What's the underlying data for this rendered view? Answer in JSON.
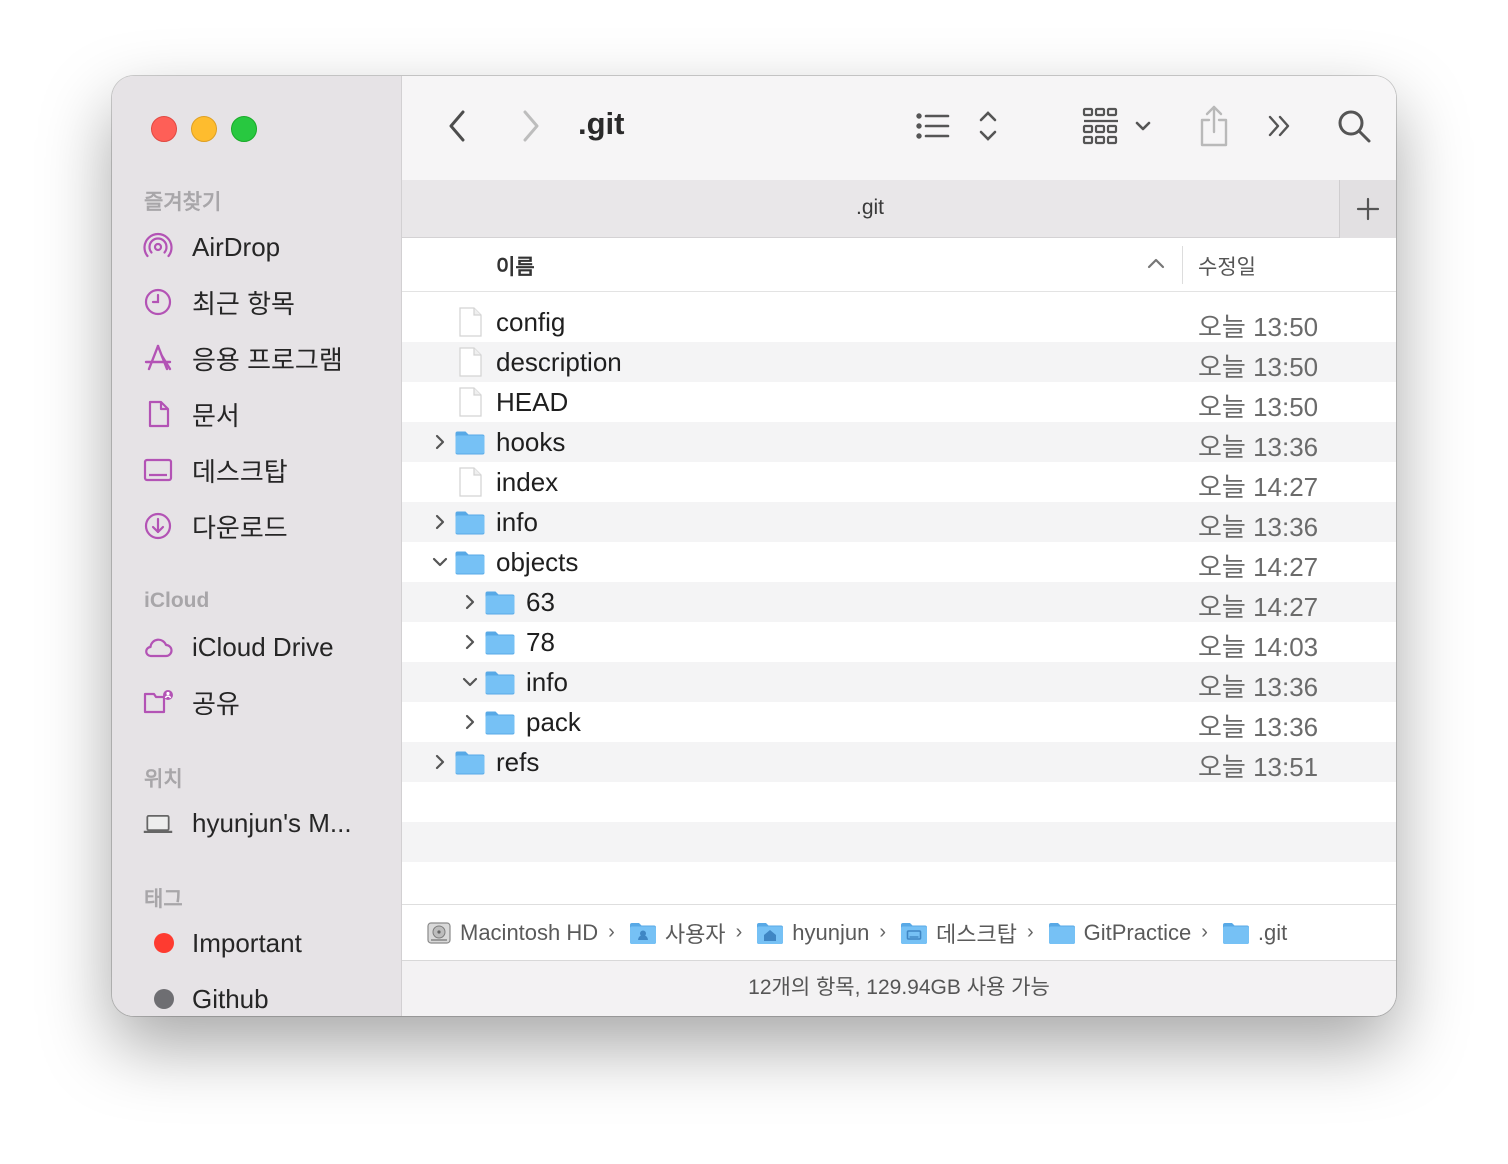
{
  "sidebar": {
    "sections": [
      {
        "title": "즐겨찾기",
        "items": [
          {
            "label": "AirDrop",
            "icon": "airdrop-icon"
          },
          {
            "label": "최근 항목",
            "icon": "clock-icon"
          },
          {
            "label": "응용 프로그램",
            "icon": "applications-icon"
          },
          {
            "label": "문서",
            "icon": "document-icon"
          },
          {
            "label": "데스크탑",
            "icon": "desktop-icon"
          },
          {
            "label": "다운로드",
            "icon": "download-icon"
          }
        ]
      },
      {
        "title": "iCloud",
        "items": [
          {
            "label": "iCloud Drive",
            "icon": "cloud-icon"
          },
          {
            "label": "공유",
            "icon": "shared-folder-icon"
          }
        ]
      },
      {
        "title": "위치",
        "items": [
          {
            "label": "hyunjun's M...",
            "icon": "laptop-icon"
          }
        ]
      },
      {
        "title": "태그",
        "items": [
          {
            "label": "Important",
            "color": "#fe3b30"
          },
          {
            "label": "Github",
            "color": "#6e6e72"
          }
        ]
      }
    ]
  },
  "toolbar": {
    "title": ".git"
  },
  "tab": {
    "label": ".git"
  },
  "columns": {
    "name": "이름",
    "modified": "수정일"
  },
  "rows": [
    {
      "name": "config",
      "date": "오늘 13:50",
      "kind": "file",
      "depth": 0,
      "expand": "none"
    },
    {
      "name": "description",
      "date": "오늘 13:50",
      "kind": "file",
      "depth": 0,
      "expand": "none"
    },
    {
      "name": "HEAD",
      "date": "오늘 13:50",
      "kind": "file",
      "depth": 0,
      "expand": "none"
    },
    {
      "name": "hooks",
      "date": "오늘 13:36",
      "kind": "folder",
      "depth": 0,
      "expand": "collapsed"
    },
    {
      "name": "index",
      "date": "오늘 14:27",
      "kind": "file",
      "depth": 0,
      "expand": "none"
    },
    {
      "name": "info",
      "date": "오늘 13:36",
      "kind": "folder",
      "depth": 0,
      "expand": "collapsed"
    },
    {
      "name": "objects",
      "date": "오늘 14:27",
      "kind": "folder",
      "depth": 0,
      "expand": "expanded"
    },
    {
      "name": "63",
      "date": "오늘 14:27",
      "kind": "folder",
      "depth": 1,
      "expand": "collapsed"
    },
    {
      "name": "78",
      "date": "오늘 14:03",
      "kind": "folder",
      "depth": 1,
      "expand": "collapsed"
    },
    {
      "name": "info",
      "date": "오늘 13:36",
      "kind": "folder",
      "depth": 1,
      "expand": "expanded"
    },
    {
      "name": "pack",
      "date": "오늘 13:36",
      "kind": "folder",
      "depth": 1,
      "expand": "collapsed"
    },
    {
      "name": "refs",
      "date": "오늘 13:51",
      "kind": "folder",
      "depth": 0,
      "expand": "collapsed"
    }
  ],
  "path": [
    {
      "label": "Macintosh HD",
      "icon": "hard-drive-icon"
    },
    {
      "label": "사용자",
      "icon": "users-folder-icon"
    },
    {
      "label": "hyunjun",
      "icon": "home-folder-icon"
    },
    {
      "label": "데스크탑",
      "icon": "desktop-folder-icon"
    },
    {
      "label": "GitPractice",
      "icon": "folder-icon"
    },
    {
      "label": ".git",
      "icon": "folder-icon"
    }
  ],
  "path_separator": "›",
  "status": {
    "text": "12개의 항목, 129.94GB 사용 가능"
  },
  "colors": {
    "accent": "#b353b5",
    "folder": "#5fb5ef"
  }
}
